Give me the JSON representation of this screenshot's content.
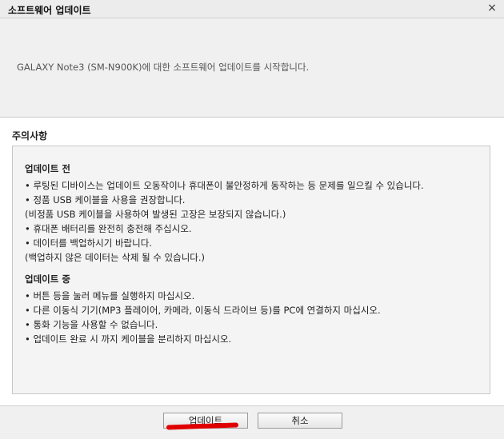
{
  "window": {
    "title": "소프트웨어 업데이트",
    "close_glyph": "×"
  },
  "header": {
    "message": "GALAXY Note3 (SM-N900K)에 대한 소프트웨어 업데이트를 시작합니다."
  },
  "notice": {
    "title": "주의사항",
    "before": {
      "heading": "업데이트 전",
      "lines": [
        "• 루팅된 디바이스는 업데이트 오동작이나 휴대폰이 불안정하게 동작하는 등 문제를 일으킬 수 있습니다.",
        "• 정품 USB 케이블을 사용을 권장합니다.",
        "(비정품 USB 케이블을 사용하여 발생된 고장은 보장되지 않습니다.)",
        "• 휴대폰 배터리를 완전히 충전해 주십시오.",
        "• 데이터를 백업하시기 바랍니다.",
        "(백업하지 않은 데이터는 삭제 될 수 있습니다.)"
      ]
    },
    "during": {
      "heading": "업데이트 중",
      "lines": [
        "• 버튼 등을 눌러 메뉴를 실행하지 마십시오.",
        "• 다른 이동식 기기(MP3 플레이어, 카메라, 이동식 드라이브 등)를 PC에 연결하지 마십시오.",
        "• 통화 기능을 사용할 수 없습니다.",
        "• 업데이트 완료 시 까지 케이블을 분리하지 마십시오."
      ]
    }
  },
  "buttons": {
    "update_label": "업데이트",
    "cancel_label": "취소"
  },
  "colors": {
    "annotation_mark": "#e00000"
  }
}
